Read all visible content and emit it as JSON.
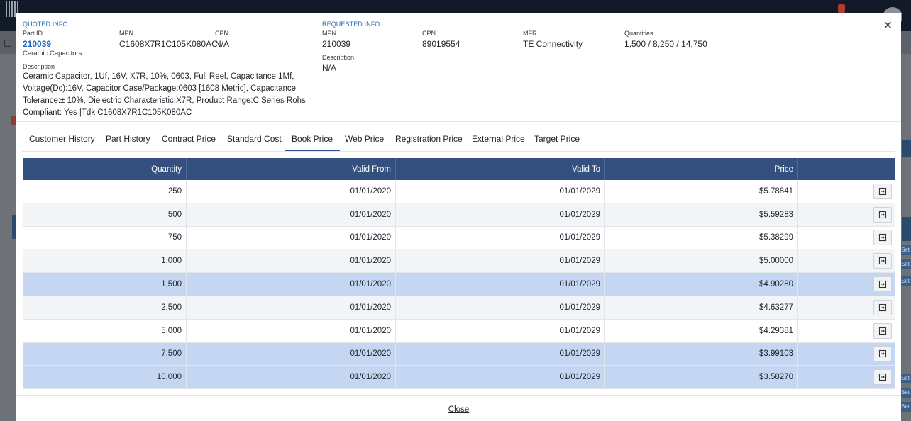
{
  "quoted": {
    "section_title": "QUOTED INFO",
    "part_id_label": "Part ID",
    "part_id": "210039",
    "category": "Ceramic Capacitors",
    "mpn_label": "MPN",
    "mpn": "C1608X7R1C105K080AC",
    "cpn_label": "CPN",
    "cpn": "N/A",
    "description_label": "Description",
    "description": "Ceramic Capacitor, 1Uf, 16V, X7R, 10%, 0603, Full Reel, Capacitance:1Mf, Voltage(Dc):16V, Capacitor Case/Package:0603 [1608 Metric], Capacitance Tolerance:± 10%, Dielectric Characteristic:X7R, Product Range:C Series Rohs Compliant: Yes |Tdk C1608X7R1C105K080AC"
  },
  "requested": {
    "section_title": "REQUESTED INFO",
    "mpn_label": "MPN",
    "mpn": "210039",
    "cpn_label": "CPN",
    "cpn": "89019554",
    "mfr_label": "MFR",
    "mfr": "TE Connectivity",
    "quantities_label": "Quantities",
    "quantities": "1,500 / 8,250 / 14,750",
    "description_label": "Description",
    "description": "N/A"
  },
  "tabs": [
    {
      "label": "Customer History"
    },
    {
      "label": "Part History"
    },
    {
      "label": "Contract Price"
    },
    {
      "label": "Standard Cost"
    },
    {
      "label": "Book Price",
      "active": true
    },
    {
      "label": "Web Price"
    },
    {
      "label": "Registration Price"
    },
    {
      "label": "External Price"
    },
    {
      "label": "Target Price"
    }
  ],
  "table": {
    "columns": [
      "Quantity",
      "Valid From",
      "Valid To",
      "Price",
      ""
    ],
    "rows": [
      {
        "quantity": "250",
        "valid_from": "01/01/2020",
        "valid_to": "01/01/2029",
        "price": "$5.78841",
        "state": "white"
      },
      {
        "quantity": "500",
        "valid_from": "01/01/2020",
        "valid_to": "01/01/2029",
        "price": "$5.59283",
        "state": "alt"
      },
      {
        "quantity": "750",
        "valid_from": "01/01/2020",
        "valid_to": "01/01/2029",
        "price": "$5.38299",
        "state": "white"
      },
      {
        "quantity": "1,000",
        "valid_from": "01/01/2020",
        "valid_to": "01/01/2029",
        "price": "$5.00000",
        "state": "alt"
      },
      {
        "quantity": "1,500",
        "valid_from": "01/01/2020",
        "valid_to": "01/01/2029",
        "price": "$4.90280",
        "state": "sel"
      },
      {
        "quantity": "2,500",
        "valid_from": "01/01/2020",
        "valid_to": "01/01/2029",
        "price": "$4.63277",
        "state": "alt"
      },
      {
        "quantity": "5,000",
        "valid_from": "01/01/2020",
        "valid_to": "01/01/2029",
        "price": "$4.29381",
        "state": "white"
      },
      {
        "quantity": "7,500",
        "valid_from": "01/01/2020",
        "valid_to": "01/01/2029",
        "price": "$3.99103",
        "state": "sel"
      },
      {
        "quantity": "10,000",
        "valid_from": "01/01/2020",
        "valid_to": "01/01/2029",
        "price": "$3.58270",
        "state": "sel"
      }
    ],
    "row_action_icon": "apply-price-icon"
  },
  "footer": {
    "close_label": "Close"
  },
  "modal_close_icon": "close-icon",
  "background": {
    "right_tag_text": "Set"
  },
  "colors": {
    "header_bg": "#34507e",
    "selected_row": "#c5d6f2",
    "link": "#2366c4",
    "active_tab": "#2f5597"
  }
}
